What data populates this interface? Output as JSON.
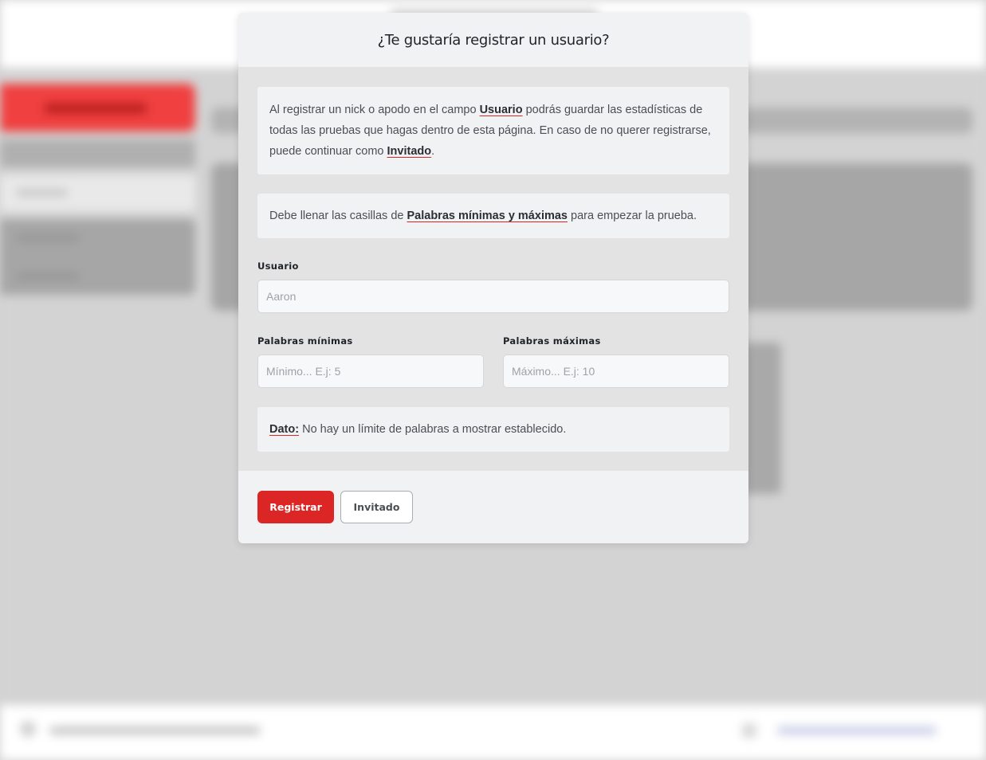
{
  "modal": {
    "title": "¿Te gustaría registrar un usuario?",
    "intro": {
      "text1": "Al registrar un nick o apodo en el campo ",
      "link1": "Usuario",
      "text2": " podrás guardar las estadísticas de todas las pruebas que hagas dentro de esta página. En caso de no querer registrarse, puede continuar como ",
      "link2": "Invitado",
      "text3": "."
    },
    "notice": {
      "text1": "Debe llenar las casillas de ",
      "link": "Palabras mínimas y máximas",
      "text2": " para empezar la prueba."
    },
    "usuario": {
      "label": "Usuario",
      "placeholder": "Aaron"
    },
    "min_words": {
      "label": "Palabras mínimas",
      "placeholder": "Mínimo... E.j: 5"
    },
    "max_words": {
      "label": "Palabras máximas",
      "placeholder": "Máximo... E.j: 10"
    },
    "tip": {
      "prefix": "Dato:",
      "text": " No hay un límite de palabras a mostrar establecido."
    },
    "buttons": {
      "register": "Registrar",
      "guest": "Invitado"
    }
  },
  "colors": {
    "accent": "#dc2626",
    "overlay": "#d3d3d3"
  }
}
